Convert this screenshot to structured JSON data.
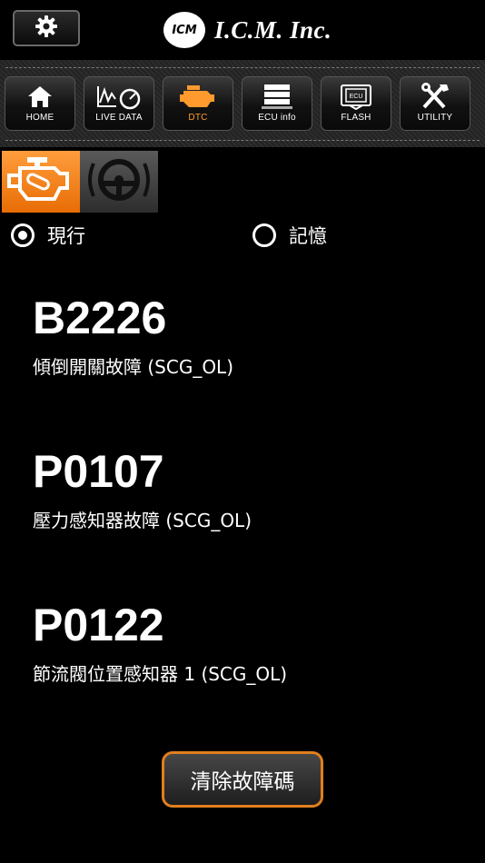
{
  "header": {
    "settings_icon": "gear-icon",
    "logo_text": "ICM",
    "brand_name": "I.C.M. Inc."
  },
  "nav": {
    "items": [
      {
        "label": "HOME",
        "icon": "home-icon"
      },
      {
        "label": "LIVE DATA",
        "icon": "live-data-gauge-icon"
      },
      {
        "label": "DTC",
        "icon": "engine-check-icon",
        "active": true
      },
      {
        "label": "ECU info",
        "icon": "ecu-info-icon"
      },
      {
        "label": "FLASH",
        "icon": "ecu-flash-icon"
      },
      {
        "label": "UTILITY",
        "icon": "tools-icon"
      }
    ]
  },
  "subtabs": [
    {
      "icon": "engine-warning-icon",
      "selected": true
    },
    {
      "icon": "steering-wheel-warning-icon",
      "selected": false
    }
  ],
  "mode": {
    "current_label": "現行",
    "memory_label": "記憶",
    "selected": "current"
  },
  "dtcs": [
    {
      "code": "B2226",
      "description": "傾倒開關故障 (SCG_OL)"
    },
    {
      "code": "P0107",
      "description": "壓力感知器故障 (SCG_OL)"
    },
    {
      "code": "P0122",
      "description": "節流閥位置感知器 1 (SCG_OL)"
    }
  ],
  "actions": {
    "clear_label": "清除故障碼"
  },
  "colors": {
    "accent": "#e07f1e",
    "background": "#000000"
  }
}
